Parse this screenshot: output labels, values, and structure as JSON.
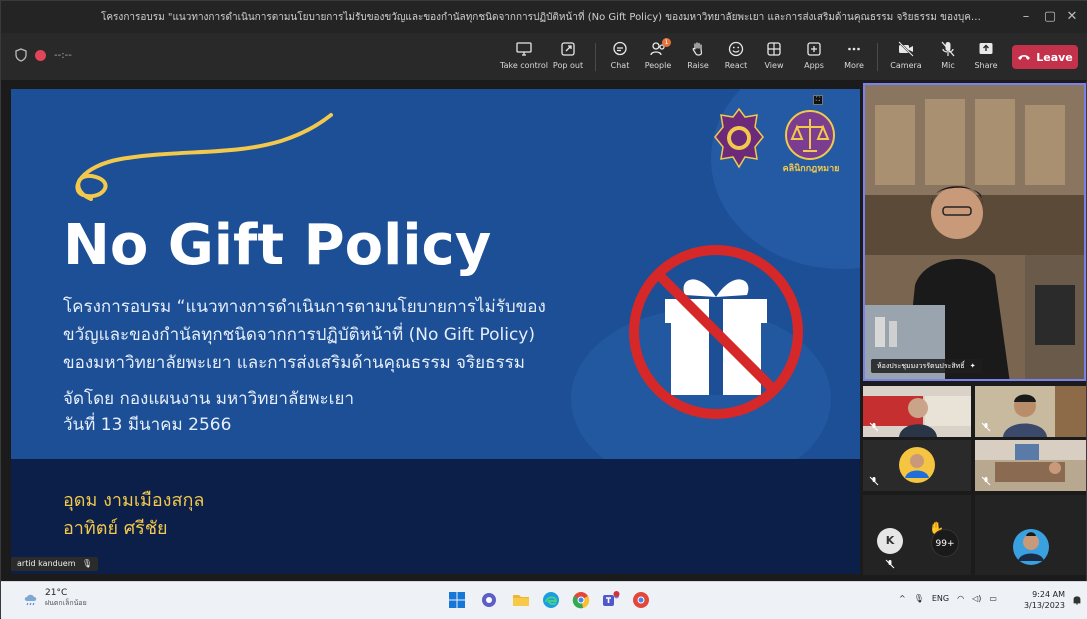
{
  "window": {
    "title": "โครงการอบรม \"แนวทางการดำเนินการตามนโยบายการไม่รับของขวัญและของกำนัลทุกชนิดจากการปฏิบัติหน้าที่ (No Gift Policy) ของมหาวิทยาลัยพะเยา และการส่งเสริมด้านคุณธรรม จริยธรรม ของบุคลากรมหาวิทยาลัยพ..."
  },
  "meeting": {
    "timer": "--:--",
    "toolbar": [
      {
        "id": "take-control",
        "label": "Take control",
        "icon": "take-control-icon"
      },
      {
        "id": "pop-out",
        "label": "Pop out",
        "icon": "pop-out-icon"
      },
      {
        "id": "chat",
        "label": "Chat",
        "icon": "chat-icon"
      },
      {
        "id": "people",
        "label": "People",
        "icon": "people-icon"
      },
      {
        "id": "raise",
        "label": "Raise",
        "icon": "raise-hand-icon"
      },
      {
        "id": "react",
        "label": "React",
        "icon": "react-icon"
      },
      {
        "id": "view",
        "label": "View",
        "icon": "view-icon"
      },
      {
        "id": "apps",
        "label": "Apps",
        "icon": "apps-icon"
      },
      {
        "id": "more",
        "label": "More",
        "icon": "more-icon"
      },
      {
        "id": "camera",
        "label": "Camera",
        "icon": "camera-off-icon"
      },
      {
        "id": "mic",
        "label": "Mic",
        "icon": "mic-off-icon"
      },
      {
        "id": "share",
        "label": "Share",
        "icon": "share-icon"
      }
    ],
    "people_badge": "1",
    "leave_label": "Leave",
    "presenter_name": "artid kanduem",
    "main_video_label": "ห้องประชุมมงวรรัตนประสิทธิ์",
    "avatar_initial": "K",
    "overflow_count": "99+"
  },
  "slide": {
    "title": "No Gift Policy",
    "lines": [
      "โครงการอบรม “แนวทางการดำเนินการตามนโยบายการไม่รับของ",
      "ขวัญและของกำนัลทุกชนิดจากการปฏิบัติหน้าที่ (No Gift Policy)",
      "ของมหาวิทยาลัยพะเยา และการส่งเสริมด้านคุณธรรม จริยธรรม"
    ],
    "organizer": "จัดโดย กองแผนงาน มหาวิทยาลัยพะเยา",
    "date": "วันที่ 13 มีนาคม 2566",
    "speakers": [
      "อุดม งามเมืองสกุล",
      "อาทิตย์ ศรีชัย"
    ],
    "logo2_caption": "คลินิกกฎหมาย",
    "colors": {
      "primary": "#1c4f95",
      "dark": "#0b1f48",
      "gold": "#f2c94c"
    }
  },
  "taskbar": {
    "temperature": "21°C",
    "weather": "ฝนตกเล็กน้อย",
    "language": "ENG",
    "time": "9:24 AM",
    "date": "3/13/2023"
  }
}
